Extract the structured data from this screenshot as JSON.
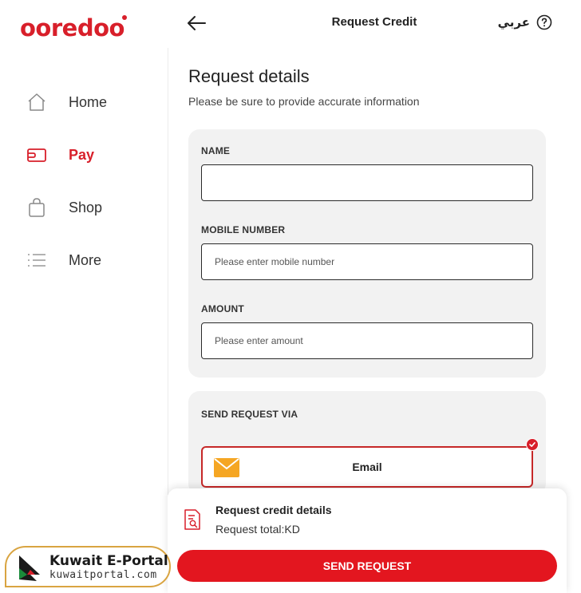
{
  "brand": {
    "logo_text": "ooredoo",
    "color": "#d81f2a"
  },
  "header": {
    "title": "Request Credit",
    "lang_link": "عربي",
    "back_icon": "arrow-left-icon",
    "help_icon": "question-circle-icon"
  },
  "sidebar": {
    "items": [
      {
        "label": "Home",
        "icon": "home-icon",
        "active": false
      },
      {
        "label": "Pay",
        "icon": "wallet-icon",
        "active": true
      },
      {
        "label": "Shop",
        "icon": "shopping-bag-icon",
        "active": false
      },
      {
        "label": "More",
        "icon": "list-icon",
        "active": false
      }
    ]
  },
  "main": {
    "title": "Request details",
    "subtitle": "Please be sure to provide accurate information",
    "form": {
      "name": {
        "label": "NAME",
        "value": "",
        "placeholder": ""
      },
      "mobile": {
        "label": "MOBILE NUMBER",
        "value": "",
        "placeholder": "Please enter mobile number"
      },
      "amount": {
        "label": "AMOUNT",
        "value": "",
        "placeholder": "Please enter amount"
      }
    },
    "send_via": {
      "label": "SEND REQUEST VIA",
      "selected_option": "Email",
      "option_icon": "envelope-icon"
    }
  },
  "summary": {
    "title": "Request credit details",
    "total": "Request total:KD",
    "icon": "document-search-icon",
    "button": "SEND REQUEST"
  },
  "watermark": {
    "title": "Kuwait E-Portal",
    "url": "kuwaitportal.com"
  },
  "colors": {
    "accent": "#e3161f",
    "card_bg": "#f2f2f2",
    "email_icon": "#f5a623"
  }
}
